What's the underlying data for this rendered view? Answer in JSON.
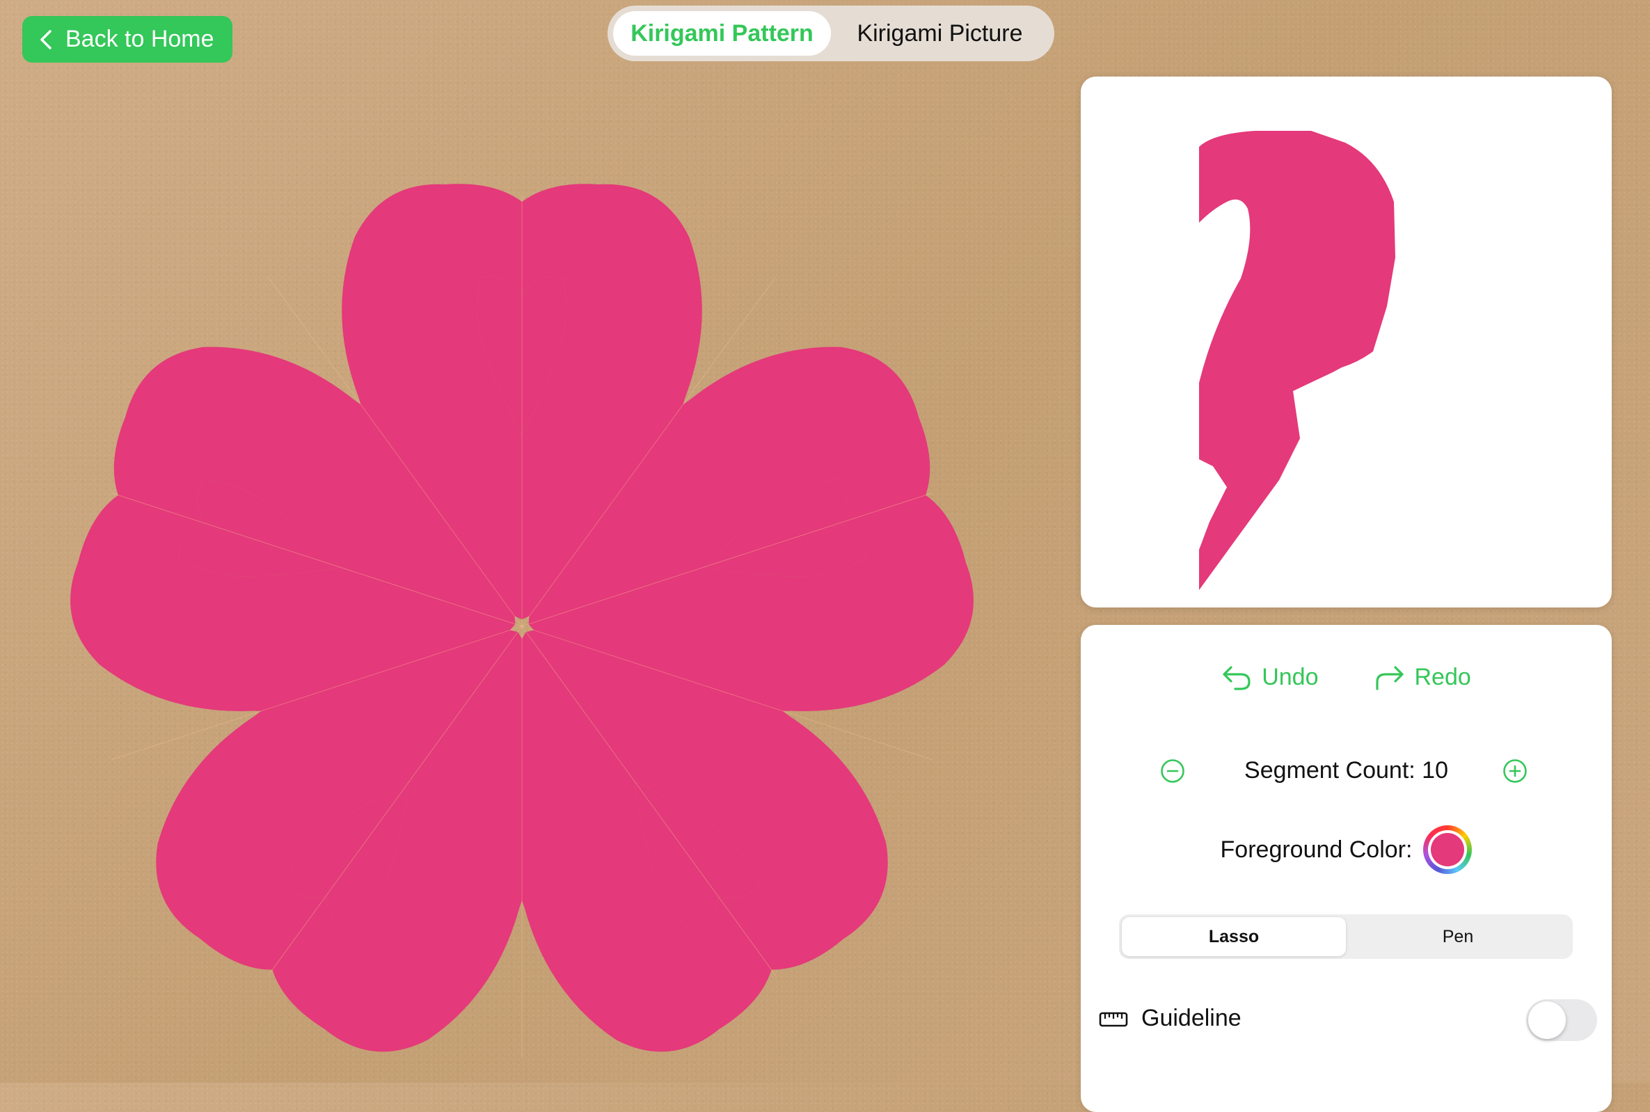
{
  "nav": {
    "back_label": "Back to Home"
  },
  "tabs": [
    {
      "label": "Kirigami Pattern",
      "active": true
    },
    {
      "label": "Kirigami Picture",
      "active": false
    }
  ],
  "pattern": {
    "color": "#e4397a",
    "segments": 10
  },
  "history": {
    "undo_label": "Undo",
    "redo_label": "Redo"
  },
  "segment_count": {
    "label": "Segment Count: 10",
    "value": 10
  },
  "foreground": {
    "label": "Foreground Color:",
    "color": "#e4397a"
  },
  "tools": {
    "options": [
      "Lasso",
      "Pen"
    ],
    "selected": "Lasso"
  },
  "guideline": {
    "label": "Guideline",
    "enabled": false
  },
  "colors": {
    "accent": "#34c759",
    "pattern": "#e4397a"
  }
}
